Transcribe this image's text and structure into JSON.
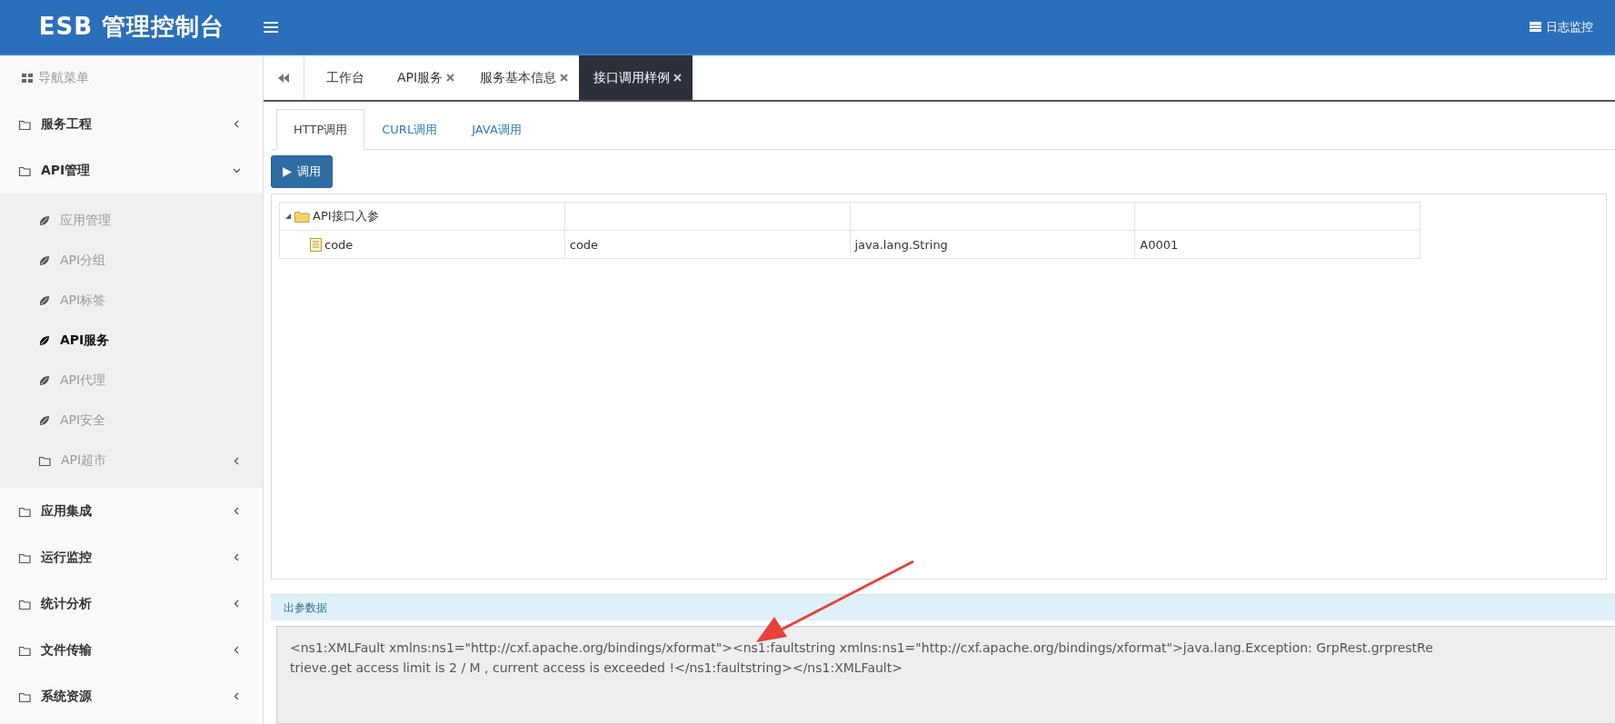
{
  "header": {
    "brand": "ESB 管理控制台",
    "log_link": "日志监控"
  },
  "sidebar": {
    "title": "导航菜单",
    "items": [
      {
        "label": "服务工程",
        "kind": "group",
        "expanded": false
      },
      {
        "label": "API管理",
        "kind": "group",
        "expanded": true,
        "children": [
          {
            "label": "应用管理",
            "kind": "leaf",
            "selected": false
          },
          {
            "label": "API分组",
            "kind": "leaf",
            "selected": false
          },
          {
            "label": "API标签",
            "kind": "leaf",
            "selected": false
          },
          {
            "label": "API服务",
            "kind": "leaf",
            "selected": true
          },
          {
            "label": "API代理",
            "kind": "leaf",
            "selected": false
          },
          {
            "label": "API安全",
            "kind": "leaf",
            "selected": false
          },
          {
            "label": "API超市",
            "kind": "group",
            "expanded": false
          }
        ]
      },
      {
        "label": "应用集成",
        "kind": "group",
        "expanded": false
      },
      {
        "label": "运行监控",
        "kind": "group",
        "expanded": false
      },
      {
        "label": "统计分析",
        "kind": "group",
        "expanded": false
      },
      {
        "label": "文件传输",
        "kind": "group",
        "expanded": false
      },
      {
        "label": "系统资源",
        "kind": "group",
        "expanded": false
      }
    ]
  },
  "page_tabs": [
    {
      "label": "工作台",
      "closable": false,
      "selected": false
    },
    {
      "label": "API服务",
      "closable": true,
      "selected": false
    },
    {
      "label": "服务基本信息",
      "closable": true,
      "selected": false
    },
    {
      "label": "接口调用样例",
      "closable": true,
      "selected": true
    }
  ],
  "call_tabs": [
    {
      "label": "HTTP调用",
      "selected": true
    },
    {
      "label": "CURL调用",
      "selected": false
    },
    {
      "label": "JAVA调用",
      "selected": false
    }
  ],
  "invoke_button": "调用",
  "params_table": {
    "rows": [
      {
        "name": "API接口入参",
        "kind": "folder",
        "expanded": true,
        "children": [
          {
            "name": "code",
            "kind": "file",
            "column_2": "code",
            "column_3": "java.lang.String",
            "column_4": "A0001"
          }
        ]
      }
    ]
  },
  "output": {
    "title": "出参数据",
    "text": "<ns1:XMLFault xmlns:ns1=\"http://cxf.apache.org/bindings/xformat\"><ns1:faultstring xmlns:ns1=\"http://cxf.apache.org/bindings/xformat\">java.lang.Exception: GrpRest.grprestRetrieve.get access limit is 2 / M , current access is exceeded !</ns1:faultstring></ns1:XMLFault>"
  }
}
